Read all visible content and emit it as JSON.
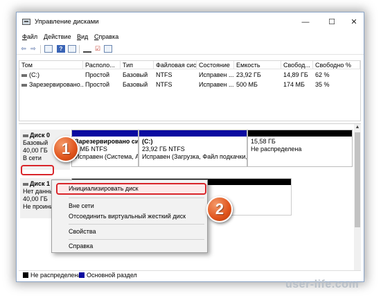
{
  "window": {
    "title": "Управление дисками",
    "controls": {
      "minimize": "—",
      "maximize": "☐",
      "close": "✕"
    }
  },
  "menu": [
    {
      "first": "Ф",
      "rest": "айл"
    },
    {
      "first": "Д",
      "rest": "ействие"
    },
    {
      "first": "В",
      "rest": "ид"
    },
    {
      "first": "С",
      "rest": "правка"
    }
  ],
  "toolbar": {
    "icons": [
      "back-icon",
      "forward-icon",
      "properties-icon",
      "help-icon",
      "console-icon",
      "connect-icon",
      "check-icon",
      "layout-icon"
    ],
    "back": "⇦",
    "forward": "⇨",
    "help": "?"
  },
  "volume_table": {
    "columns": [
      "Том",
      "Располо...",
      "Тип",
      "Файловая сист...",
      "Состояние",
      "Емкость",
      "Свобод...",
      "Свободно %"
    ],
    "rows": [
      [
        "(C:)",
        "Простой",
        "Базовый",
        "NTFS",
        "Исправен ...",
        "23,92 ГБ",
        "14,89 ГБ",
        "62 %"
      ],
      [
        "Зарезервировано...",
        "Простой",
        "Базовый",
        "NTFS",
        "Исправен ...",
        "500 МБ",
        "174 МБ",
        "35 %"
      ]
    ]
  },
  "disk0": {
    "name": "Диск 0",
    "type": "Базовый",
    "size": "40,00 ГБ",
    "status": "В сети",
    "partitions": [
      {
        "title": "Зарезервировано си",
        "line1": "0 МБ NTFS",
        "line2": "Исправен (Система, А"
      },
      {
        "title": "(C:)",
        "line1": "23,92 ГБ NTFS",
        "line2": "Исправен (Загрузка, Файл подкачки,"
      },
      {
        "title": "",
        "line1": "15,58 ГБ",
        "line2": "Не распределена"
      }
    ]
  },
  "disk1": {
    "name": "Диск 1",
    "type": "Нет данных",
    "size": "40,00 ГБ",
    "status": "Не проини"
  },
  "context_menu": {
    "items": [
      "Инициализировать диск",
      "Вне сети",
      "Отсоединить виртуальный жесткий диск",
      "Свойства",
      "Справка"
    ]
  },
  "legend": [
    {
      "label": "Не распределена",
      "color": "#000000"
    },
    {
      "label": "Основной раздел",
      "color": "#0a0aa0"
    }
  ],
  "callouts": [
    "1",
    "2"
  ],
  "watermark": "user-life.com"
}
